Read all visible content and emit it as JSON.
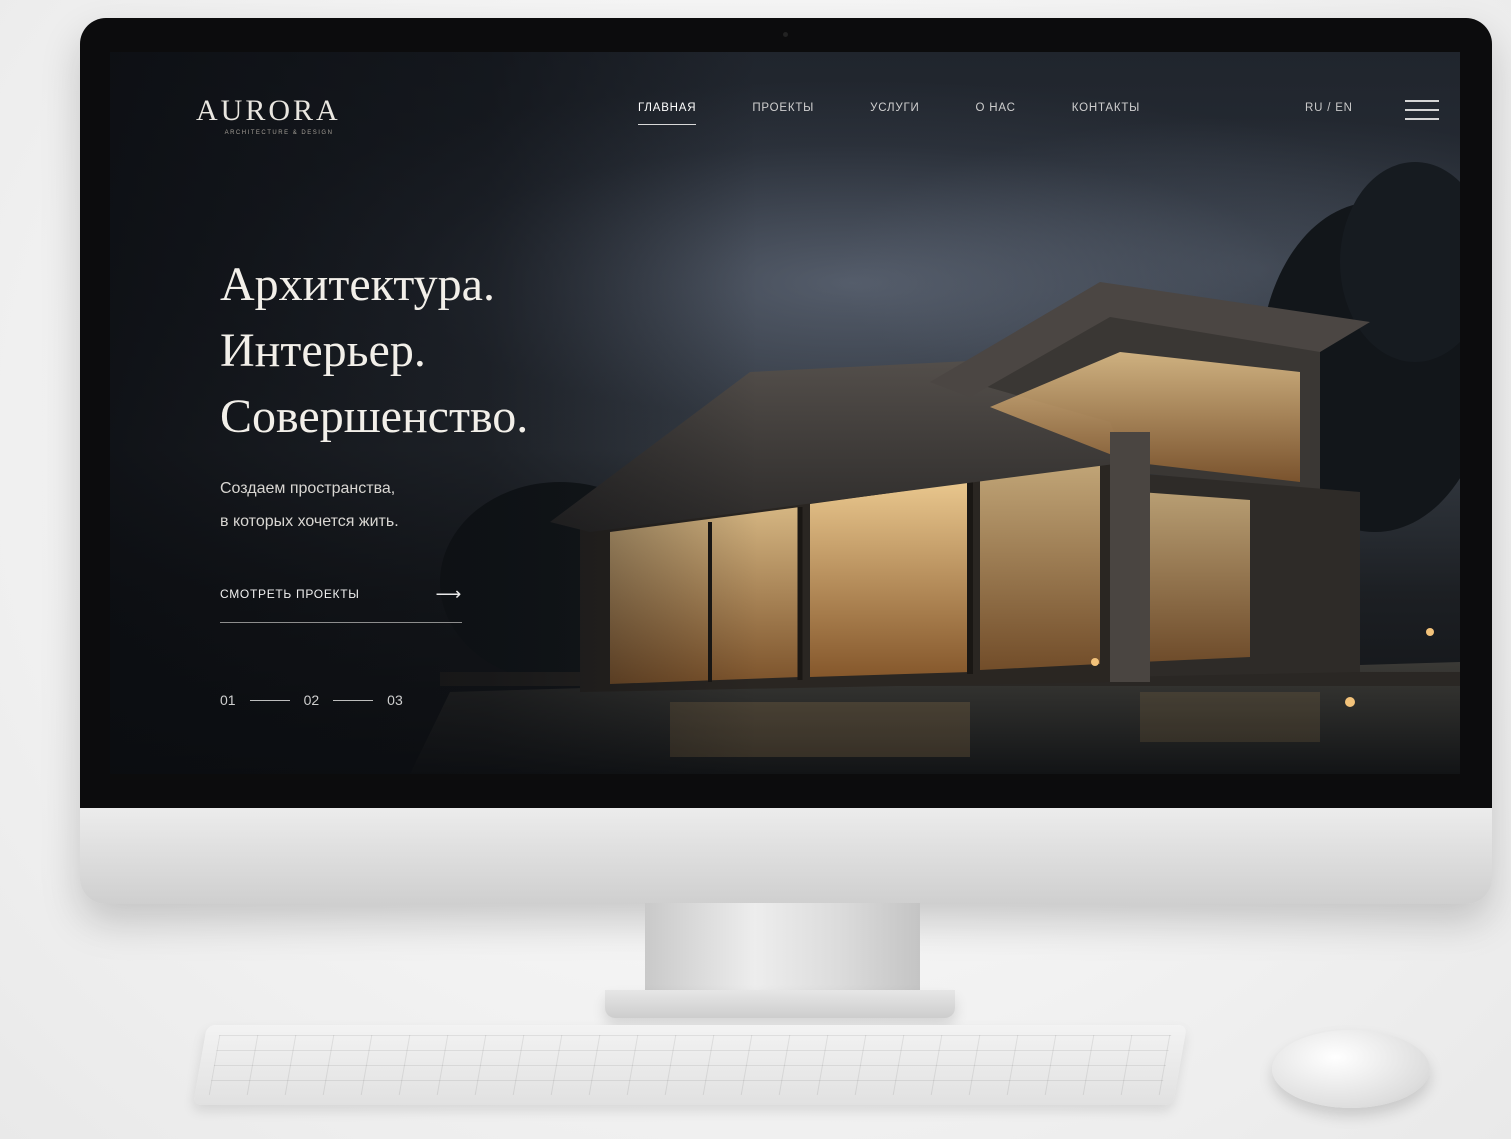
{
  "site": {
    "logo": "AURORA",
    "logo_tagline": "ARCHITECTURE & DESIGN"
  },
  "nav": {
    "items": [
      {
        "label": "ГЛАВНАЯ",
        "active": true
      },
      {
        "label": "ПРОЕКТЫ",
        "active": false
      },
      {
        "label": "УСЛУГИ",
        "active": false
      },
      {
        "label": "О НАС",
        "active": false
      },
      {
        "label": "КОНТАКТЫ",
        "active": false
      }
    ],
    "language": "RU / EN",
    "menu_icon": "hamburger-menu-icon"
  },
  "hero": {
    "title_lines": [
      "Архитектура.",
      "Интерьер.",
      "Совершенство."
    ],
    "subtitle_lines": [
      "Создаем пространства,",
      "в которых хочется жить."
    ],
    "cta_label": "СМОТРЕТЬ ПРОЕКТЫ",
    "cta_icon": "arrow-right-icon"
  },
  "slider": {
    "slides": [
      "01",
      "02",
      "03"
    ],
    "current": "01"
  },
  "colors": {
    "screen_background": "#1d2229",
    "text_primary": "#f2efe9",
    "window_light": "#e8b874",
    "device_silver": "#d9d9d9"
  }
}
